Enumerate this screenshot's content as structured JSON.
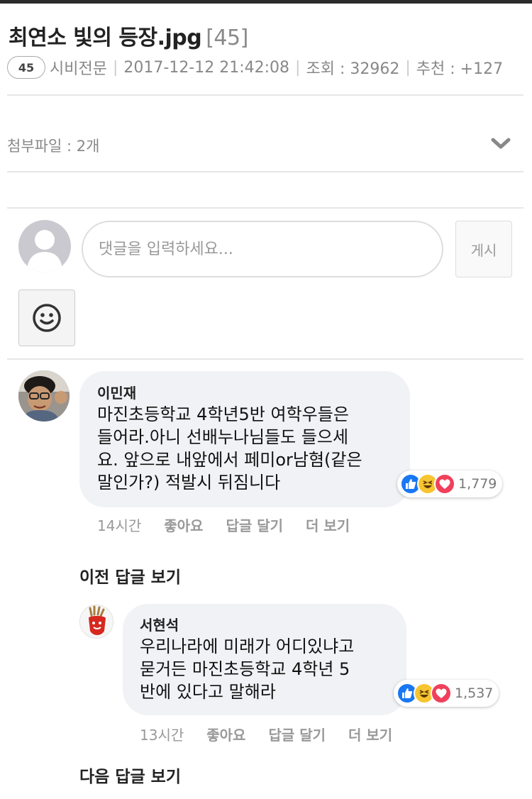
{
  "post": {
    "title": "최연소 빛의 등장.jpg",
    "comment_count": "[45]",
    "badge": "45",
    "author": "시비전문",
    "datetime": "2017-12-12 21:42:08",
    "views": "조회 : 32962",
    "likes": "추천 : +127"
  },
  "attachments": {
    "label": "첨부파일 : 2개",
    "toggle_icon": "chevron-down-icon"
  },
  "comment_form": {
    "placeholder": "댓글을 입력하세요...",
    "submit_label": "게시",
    "emoji_icon": "smiley-icon"
  },
  "comments": [
    {
      "name": "이민재",
      "lines": [
        "마진초등학교 4학년5반 여학우들은",
        "들어라.아니 선배누나님들도 들으세",
        "요. 앞으로 내앞에서 페미or남혐(같은",
        "말인가?) 적발시 뒤짐니다"
      ],
      "reaction_count": "1,779",
      "time": "14시간",
      "like_label": "좋아요",
      "reply_label": "답글 달기",
      "more_label": "더 보기"
    },
    {
      "name": "서현석",
      "lines": [
        "우리나라에 미래가 어디있냐고",
        "묻거든 마진초등학교 4학년 5",
        "반에 있다고 말해라"
      ],
      "reaction_count": "1,537",
      "time": "13시간",
      "like_label": "좋아요",
      "reply_label": "답글 달기",
      "more_label": "더 보기"
    }
  ],
  "thread": {
    "prev_replies": "이전 답글 보기",
    "next_replies": "다음 답글 보기"
  },
  "colors": {
    "like": "#1877f2",
    "haha": "#f7c531",
    "love": "#f0405c",
    "bubble": "#f0f2f5"
  }
}
